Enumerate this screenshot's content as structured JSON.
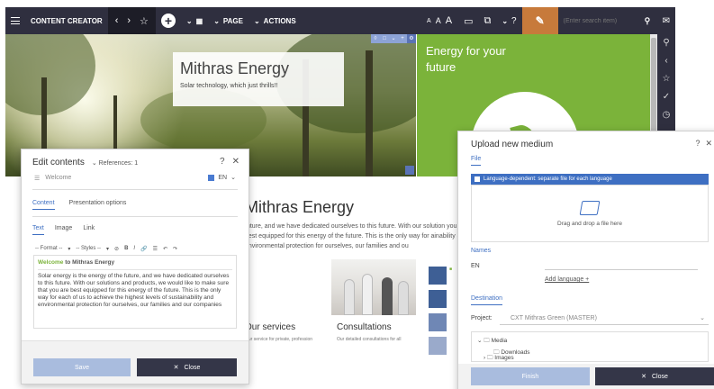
{
  "topbar": {
    "app_title": "CONTENT CREATOR",
    "page_menu": "PAGE",
    "actions_menu": "ACTIONS",
    "font_size_glyphs": [
      "A",
      "A",
      "A"
    ],
    "help": "?",
    "search_placeholder": "(Enter search item)"
  },
  "hero": {
    "title": "Mithras Energy",
    "subtitle": "Solar technology, which just thrills!!"
  },
  "green_box": {
    "title": "Energy for your future"
  },
  "page": {
    "title": "Mithras Energy",
    "text": "future, and we have dedicated ourselves to this future. With our solution you are best equipped for this energy of the future. This is the only way for ainability and environmental protection for ourselves, our families and ou",
    "tiles": [
      {
        "caption": "Our services",
        "sub": "Our service for private, profession"
      },
      {
        "caption": "Consultations",
        "sub": "Our detailed consultations for all"
      }
    ]
  },
  "edit_panel": {
    "title": "Edit contents",
    "references": "References: 1",
    "help": "?",
    "welcome_label": "Welcome",
    "language": "EN",
    "tabs": [
      "Content",
      "Presentation options"
    ],
    "subtabs": [
      "Text",
      "Image",
      "Link"
    ],
    "toolbar": {
      "format": "-- Format --",
      "styles": "-- Styles --",
      "bold": "B",
      "italic": "I"
    },
    "editor_heading_highlight": "Welcome",
    "editor_heading_rest": "to Mithras Energy",
    "editor_body": "Solar energy is the energy of the future, and we have dedicated ourselves to this future. With our solutions and products, we would like to make sure that you are best equipped for this energy of the future. This is the only way for each of us to achieve the highest levels of sustainability and environmental protection for ourselves, our families and our companies",
    "save_label": "Save",
    "close_label": "Close"
  },
  "upload_panel": {
    "title": "Upload new medium",
    "help": "?",
    "tab_file": "File",
    "language_dependent": "Language-dependent: separate file for each language",
    "drop_text": "Drag and drop a file here",
    "names_label": "Names",
    "en_label": "EN",
    "add_language": "Add language +",
    "destination_label": "Destination",
    "project_label": "Project:",
    "project_value": "CXT Mithras Green (MASTER)",
    "tree": [
      "Media",
      "Downloads",
      "Images"
    ],
    "finish_label": "Finish",
    "close_label": "Close"
  },
  "colors": {
    "topbar_bg": "#2f2f3f",
    "accent_orange": "#c77a3b",
    "brand_green": "#7bb33a",
    "link_blue": "#3e6fc2",
    "primary_dark_button": "#343648",
    "disabled_button": "#a9bcde"
  }
}
